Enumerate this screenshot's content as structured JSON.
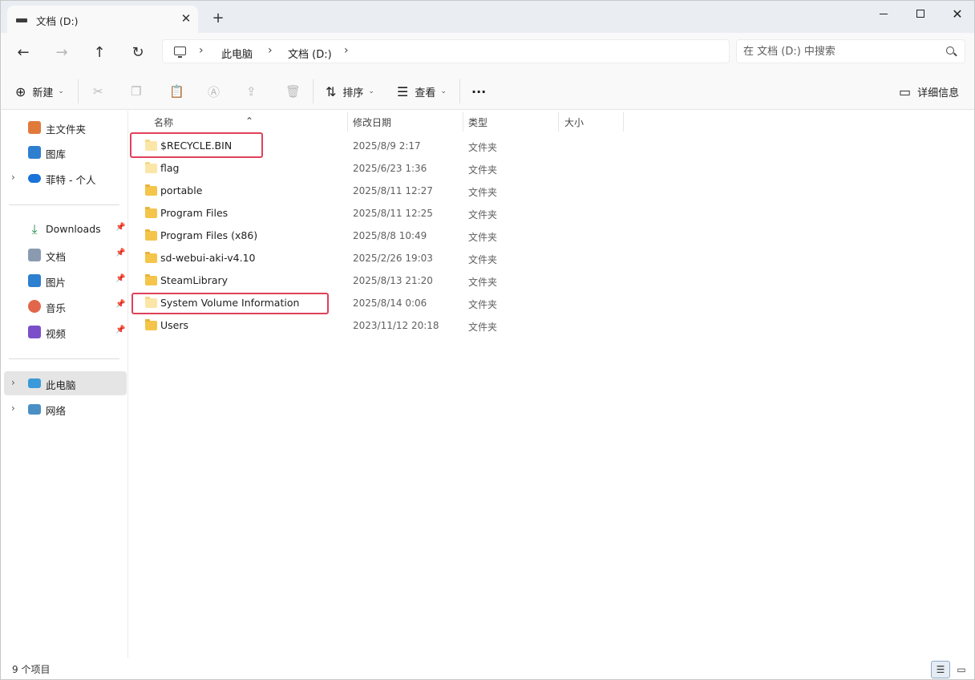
{
  "window": {
    "tab_title": "文档 (D:)",
    "tab_close": "✕",
    "new_tab": "+",
    "close": "✕"
  },
  "address": {
    "sep": "›",
    "crumbs": [
      "此电脑",
      "文档 (D:)"
    ],
    "search_placeholder": "在 文档 (D:) 中搜索"
  },
  "nav": {
    "back": "←",
    "forward": "→",
    "up": "↑",
    "refresh": "↻"
  },
  "toolbar": {
    "new_label": "新建",
    "sort_label": "排序",
    "view_label": "查看",
    "more": "···",
    "details_label": "详细信息",
    "icons": [
      "plus-circle-icon",
      "cut-icon",
      "copy-icon",
      "paste-icon",
      "rename-icon",
      "share-icon",
      "delete-icon",
      "sort-icon",
      "view-icon",
      "details-pane-icon"
    ]
  },
  "sidebar": {
    "items": [
      {
        "label": "主文件夹",
        "icon": "home-icon"
      },
      {
        "label": "图库",
        "icon": "gallery-icon"
      },
      {
        "label": "菲特 - 个人",
        "icon": "onedrive-cloud-icon"
      },
      {
        "label": "Downloads",
        "icon": "download-arrow-icon"
      },
      {
        "label": "文档",
        "icon": "document-icon"
      },
      {
        "label": "图片",
        "icon": "picture-icon"
      },
      {
        "label": "音乐",
        "icon": "music-icon"
      },
      {
        "label": "视频",
        "icon": "video-icon"
      },
      {
        "label": "此电脑",
        "icon": "computer-icon"
      },
      {
        "label": "网络",
        "icon": "network-icon"
      }
    ],
    "expander": "›",
    "pin": "📌"
  },
  "columns": {
    "name": "名称",
    "modified": "修改日期",
    "type": "类型",
    "size": "大小"
  },
  "files": [
    {
      "name": "$RECYCLE.BIN",
      "modified": "2025/8/9 2:17",
      "type": "文件夹"
    },
    {
      "name": "flag",
      "modified": "2025/6/23 1:36",
      "type": "文件夹"
    },
    {
      "name": "portable",
      "modified": "2025/8/11 12:27",
      "type": "文件夹"
    },
    {
      "name": "Program Files",
      "modified": "2025/8/11 12:25",
      "type": "文件夹"
    },
    {
      "name": "Program Files (x86)",
      "modified": "2025/8/8 10:49",
      "type": "文件夹"
    },
    {
      "name": "sd-webui-aki-v4.10",
      "modified": "2025/2/26 19:03",
      "type": "文件夹"
    },
    {
      "name": "SteamLibrary",
      "modified": "2025/8/13 21:20",
      "type": "文件夹"
    },
    {
      "name": "System Volume Information",
      "modified": "2025/8/14 0:06",
      "type": "文件夹"
    },
    {
      "name": "Users",
      "modified": "2023/11/12 20:18",
      "type": "文件夹"
    }
  ],
  "status": {
    "item_count": "9 个项目"
  },
  "colors": {
    "highlight": "#e0415a",
    "folder": "#f4c54a",
    "selected_nav": "#e5e5e5"
  }
}
